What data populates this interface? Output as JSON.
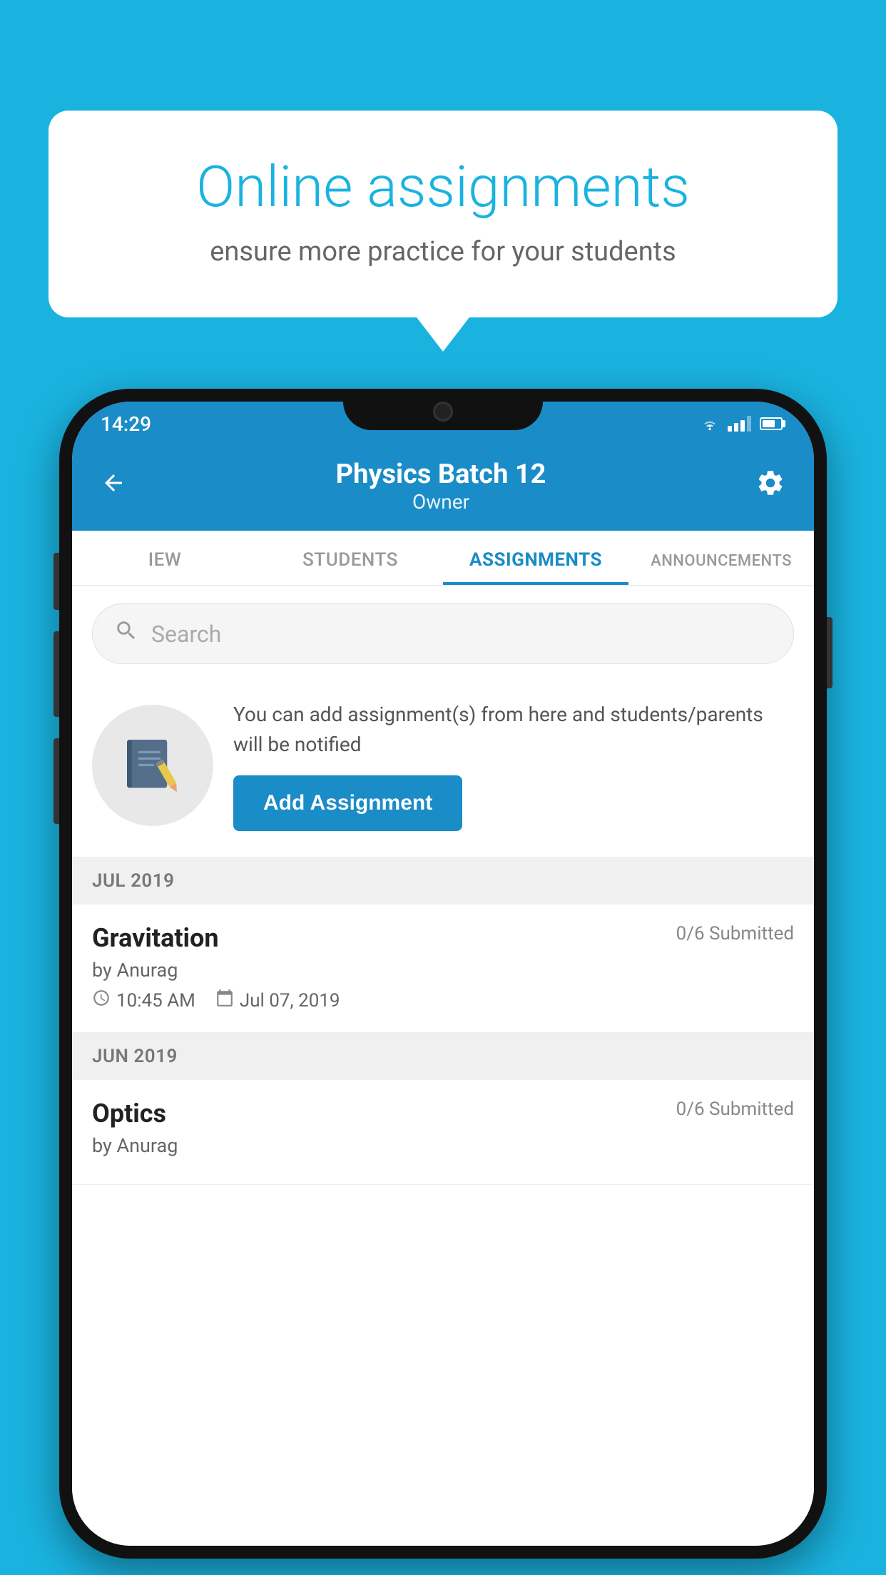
{
  "background_color": "#1ab3e0",
  "speech_bubble": {
    "title": "Online assignments",
    "subtitle": "ensure more practice for your students"
  },
  "status_bar": {
    "time": "14:29"
  },
  "header": {
    "title": "Physics Batch 12",
    "subtitle": "Owner",
    "back_label": "←",
    "settings_label": "⚙"
  },
  "tabs": [
    {
      "label": "IEW",
      "active": false
    },
    {
      "label": "STUDENTS",
      "active": false
    },
    {
      "label": "ASSIGNMENTS",
      "active": true
    },
    {
      "label": "ANNOUNCEMENTS",
      "active": false
    }
  ],
  "search": {
    "placeholder": "Search"
  },
  "promo": {
    "text": "You can add assignment(s) from here and students/parents will be notified",
    "button_label": "Add Assignment"
  },
  "sections": [
    {
      "header": "JUL 2019",
      "assignments": [
        {
          "name": "Gravitation",
          "submitted": "0/6 Submitted",
          "author": "by Anurag",
          "time": "10:45 AM",
          "date": "Jul 07, 2019"
        }
      ]
    },
    {
      "header": "JUN 2019",
      "assignments": [
        {
          "name": "Optics",
          "submitted": "0/6 Submitted",
          "author": "by Anurag",
          "time": "",
          "date": ""
        }
      ]
    }
  ]
}
